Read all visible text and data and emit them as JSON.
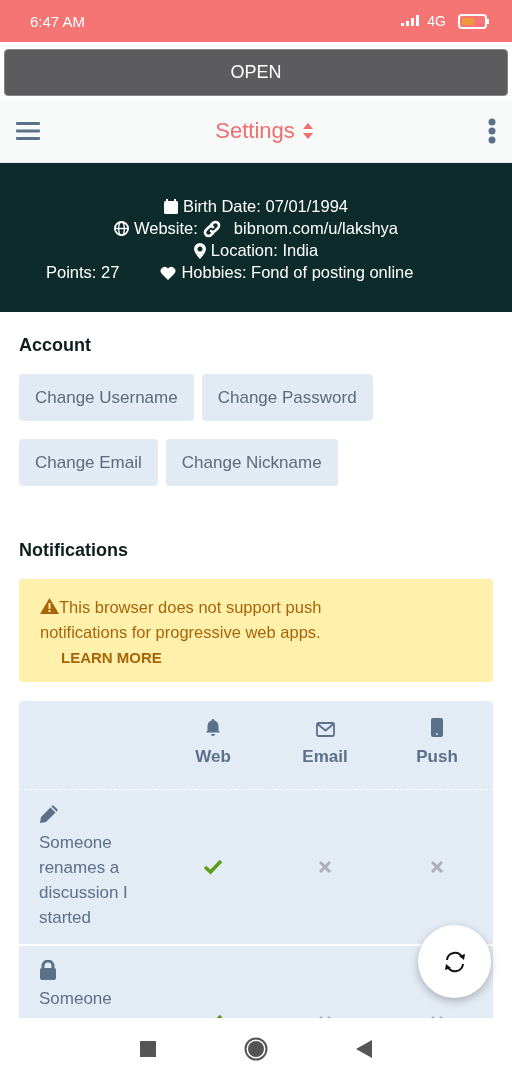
{
  "status_bar": {
    "time": "6:47 AM",
    "network": "4G"
  },
  "open_button": "OPEN",
  "header": {
    "title": "Settings"
  },
  "profile": {
    "birth_date": "Birth Date: 07/01/1994",
    "website_label": "Website:",
    "website_link": "bibnom.com/u/lakshya",
    "location": "Location: India",
    "points": "Points: 27",
    "hobbies": "Hobbies: Fond of posting online"
  },
  "account": {
    "heading": "Account",
    "buttons": [
      "Change Username",
      "Change Password",
      "Change Email",
      "Change Nickname"
    ]
  },
  "notifications": {
    "heading": "Notifications",
    "alert": {
      "message": "This browser does not support push notifications for progressive web apps.",
      "link": "LEARN MORE"
    },
    "columns": [
      {
        "kind": "web",
        "label": "Web"
      },
      {
        "kind": "email",
        "label": "Email"
      },
      {
        "kind": "push",
        "label": "Push"
      }
    ],
    "rows": [
      {
        "kind": "rename",
        "label": "Someone renames a discussion I started",
        "web": true,
        "email": false,
        "push": false
      },
      {
        "kind": "lock",
        "label": "Someone",
        "web": true,
        "email": false,
        "push": false
      }
    ]
  }
}
